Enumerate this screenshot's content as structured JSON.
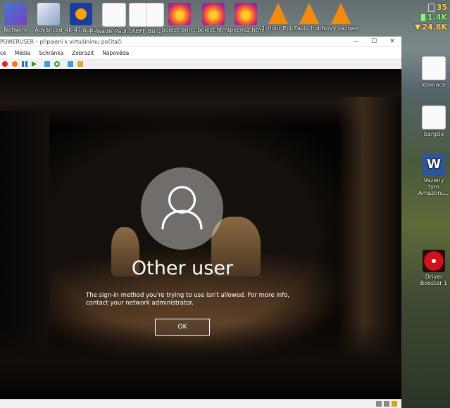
{
  "desktop": {
    "top_icons": [
      {
        "label": "Network",
        "kind": "netw"
      },
      {
        "label": "Advanced",
        "kind": "adv"
      },
      {
        "label": "4k-47.aup3",
        "kind": "audac"
      },
      {
        "label": "Wade_Paul...",
        "kind": "doc"
      },
      {
        "label": "AEFI",
        "kind": "doc"
      },
      {
        "label": "Bui...",
        "kind": "doc"
      },
      {
        "label": "bolest-prin...",
        "kind": "ff"
      },
      {
        "label": "bolest.html",
        "kind": "ff"
      },
      {
        "label": "specnaz.html",
        "kind": "ff"
      },
      {
        "label": "1-Hour Epic",
        "kind": "vlc"
      },
      {
        "label": "Zaviv hubu",
        "kind": "vlc"
      },
      {
        "label": "Novy zaznam",
        "kind": "vlc"
      }
    ],
    "right_icons": [
      {
        "label": "klamace",
        "kind": "doc"
      },
      {
        "label": "bargdo",
        "kind": "doc"
      },
      {
        "label": "Vazeny tym Amazonu...",
        "kind": "word"
      },
      {
        "label": "Driver Booster 1",
        "kind": "driver"
      }
    ],
    "stats": {
      "value1": "35",
      "value2": "1.4K",
      "value3": "24.8K",
      "value1_color": "#ffd34d",
      "value2_color": "#7cff6b",
      "value3_color": "#ffd34d"
    }
  },
  "vm_window": {
    "title": "POWERUSER – připojení k virtuálnímu počítači",
    "controls": {
      "minimize": "—",
      "maximize": "☐",
      "close": "✕"
    },
    "menu": [
      "ce",
      "Média",
      "Schránka",
      "Zobrazit",
      "Nápověda"
    ]
  },
  "login": {
    "username": "Other user",
    "message": "The sign-in method you're trying to use isn't allowed. For more info, contact your network administrator.",
    "ok_label": "OK"
  }
}
